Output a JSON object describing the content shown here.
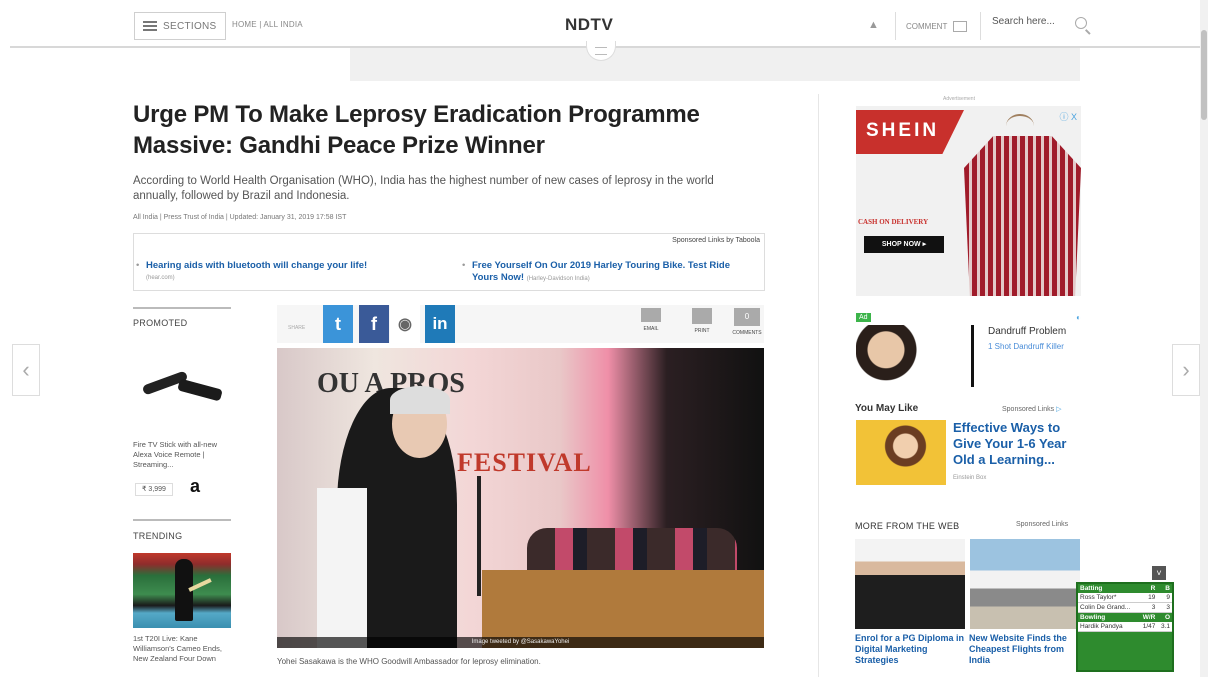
{
  "header": {
    "sections_label": "SECTIONS",
    "breadcrumb": "HOME | ALL INDIA",
    "logo": "NDTV",
    "comment_label": "COMMENT",
    "search_placeholder": "Search here..."
  },
  "article": {
    "headline": "Urge PM To Make Leprosy Eradication Programme Massive: Gandhi Peace Prize Winner",
    "synopsis": "According to World Health Organisation (WHO), India has the highest number of new cases of leprosy in the world annually, followed by Brazil and Indonesia.",
    "byline": "All India | Press Trust of India | Updated: January 31, 2019 17:58 IST",
    "image_credit": "Image tweeted by @SasakawaYohei",
    "caption": "Yohei Sasakawa is the WHO Goodwill Ambassador for leprosy elimination.",
    "photo_banner": "FESTIVAL",
    "photo_banner_top": "OU  A  PROS"
  },
  "sponsored": {
    "header": "Sponsored Links by Taboola",
    "items": [
      {
        "title": "Hearing aids with bluetooth will change your life!",
        "source": "(hear.com)"
      },
      {
        "title": "Free Yourself On Our 2019 Harley Touring Bike. Test Ride Yours Now!",
        "source": "(Harley-Davidson India)"
      }
    ]
  },
  "share": {
    "label": "SHARE",
    "twitter_glyph": "t",
    "facebook_glyph": "f",
    "reddit_glyph": "◉",
    "linkedin_glyph": "in",
    "email_label": "EMAIL",
    "print_label": "PRINT",
    "comments_label": "COMMENTS",
    "comments_count": "0"
  },
  "left_column": {
    "promoted_label": "PROMOTED",
    "promo_text": "Fire TV Stick with all-new Alexa Voice Remote | Streaming...",
    "promo_price": "₹ 3,999",
    "amazon_glyph": "a",
    "trending_label": "TRENDING",
    "trending_text": "1st T20I Live: Kane Williamson's Cameo Ends, New Zealand Four Down"
  },
  "right_column": {
    "advertisement_label": "Advertisement",
    "shein": {
      "logo": "SHEIN",
      "cod": "CASH ON DELIVERY",
      "cta": "SHOP NOW ▸",
      "ad_choices": "ⓘ X"
    },
    "dandruff_ad": {
      "badge": "Ad",
      "title": "Dandruff Problem",
      "subtitle": "1 Shot Dandruff Killer"
    },
    "you_may_like": {
      "label": "You May Like",
      "sponsored": "Sponsored Links",
      "title": "Effective Ways to Give Your 1-6 Year Old a Learning...",
      "source": "Einstein Box"
    },
    "more_from_web": {
      "label": "MORE FROM THE WEB",
      "sponsored": "Sponsored Links",
      "items": [
        "Enrol for a PG Diploma in Digital Marketing Strategies",
        "New Website Finds the Cheapest Flights from India"
      ]
    }
  },
  "score_widget": {
    "batting_header": [
      "Batting",
      "R",
      "B"
    ],
    "batting": [
      [
        "Ross Taylor*",
        "19",
        "9"
      ],
      [
        "Colin De Grand...",
        "3",
        "3"
      ]
    ],
    "bowling_header": [
      "Bowling",
      "W/R",
      "O"
    ],
    "bowling": [
      [
        "Hardik Pandya",
        "1/47",
        "3.1"
      ]
    ],
    "close_glyph": "˅"
  },
  "nav": {
    "prev_glyph": "‹",
    "next_glyph": "›"
  }
}
